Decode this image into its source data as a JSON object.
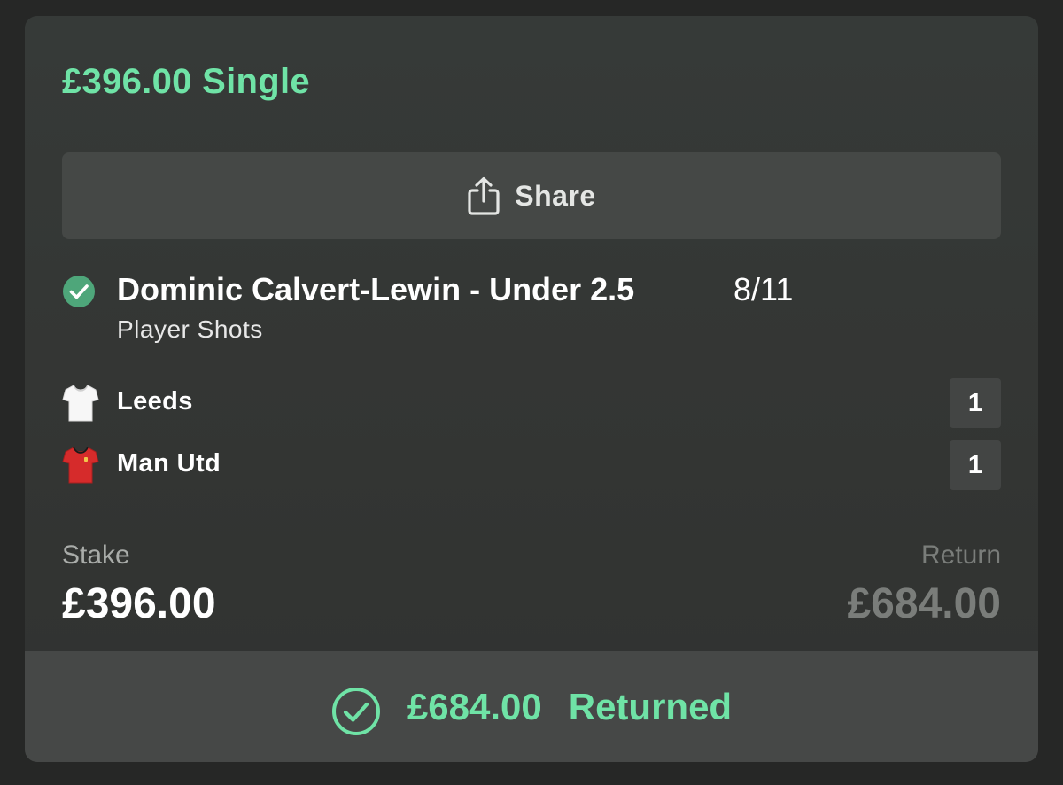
{
  "bet": {
    "title": "£396.00 Single"
  },
  "share": {
    "label": "Share",
    "icon": "share-icon"
  },
  "selection": {
    "status_icon": "check-circle-icon",
    "name": "Dominic Calvert-Lewin - Under 2.5",
    "odds": "8/11",
    "market": "Player Shots"
  },
  "teams": [
    {
      "name": "Leeds",
      "score": "1",
      "shirt_color": "#ffffff",
      "icon": "white-shirt-icon"
    },
    {
      "name": "Man Utd",
      "score": "1",
      "shirt_color": "#d62b2b",
      "icon": "red-shirt-icon"
    }
  ],
  "stake": {
    "label": "Stake",
    "value": "£396.00"
  },
  "return": {
    "label": "Return",
    "value": "£684.00"
  },
  "result": {
    "icon": "check-circle-outline-icon",
    "amount": "£684.00",
    "label": "Returned"
  },
  "colors": {
    "accent_green": "#6fe3a6",
    "check_green": "#4ea67a",
    "card_background": "#353836",
    "page_background": "#262726"
  }
}
